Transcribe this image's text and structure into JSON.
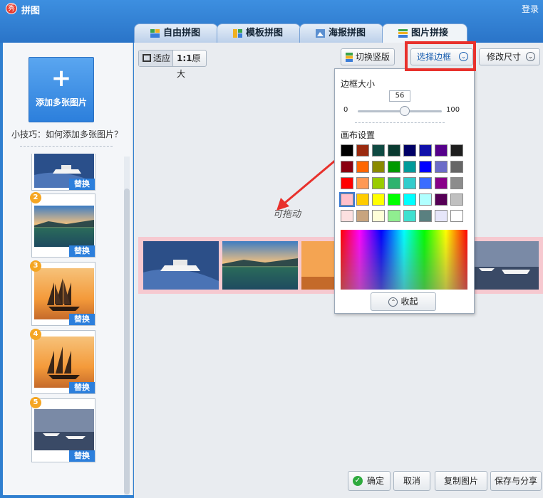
{
  "window": {
    "title": "拼图",
    "login_label": "登录"
  },
  "tabs": [
    {
      "label": "自由拼图",
      "active": false
    },
    {
      "label": "模板拼图",
      "active": false
    },
    {
      "label": "海报拼图",
      "active": false
    },
    {
      "label": "图片拼接",
      "active": true
    }
  ],
  "sidebar": {
    "add_label": "添加多张图片",
    "tip": "小技巧：如何添加多张图片？",
    "replace_label": "替换",
    "items": [
      {
        "number": "",
        "scene": "boat"
      },
      {
        "number": "2",
        "scene": "lake-sunset"
      },
      {
        "number": "3",
        "scene": "sailship"
      },
      {
        "number": "4",
        "scene": "sailship"
      },
      {
        "number": "5",
        "scene": "boats-shore"
      }
    ]
  },
  "toolbar": {
    "fit_label": "适应",
    "original_prefix": "1:1",
    "original_label": "原大",
    "vertical_label": "切换竖版",
    "border_label": "选择边框",
    "resize_label": "修改尺寸"
  },
  "canvas": {
    "hint": "可拖动",
    "strip_color": "#f6c9d0"
  },
  "popup": {
    "border_size_label": "边框大小",
    "slider_value": "56",
    "slider_min": "0",
    "slider_max": "100",
    "canvas_settings_label": "画布设置",
    "collapse_label": "收起",
    "palette": [
      [
        "#000000",
        "#9a2a0f",
        "#0f4a42",
        "#0a3a30",
        "#000066",
        "#1010aa",
        "#55008a",
        "#1e1e1e"
      ],
      [
        "#8a0010",
        "#ff6600",
        "#8a8a00",
        "#009a00",
        "#009a9a",
        "#0000ff",
        "#6c6cc8",
        "#666666"
      ],
      [
        "#ff0000",
        "#ff9955",
        "#99cc00",
        "#2eb36e",
        "#33cccc",
        "#3a6cff",
        "#880088",
        "#8c8c8c"
      ],
      [
        "#ffc0cb",
        "#ffcc00",
        "#ffff00",
        "#00ff00",
        "#00ffff",
        "#b0ffff",
        "#550055",
        "#c0c0c0"
      ],
      [
        "#fce0e0",
        "#c8a47e",
        "#ffffd8",
        "#90ee90",
        "#40e0d0",
        "#5a8080",
        "#e6e6fa",
        "#ffffff"
      ]
    ],
    "selected_swatch": "#ffc0cb"
  },
  "bottom": {
    "ok_label": "确定",
    "cancel_label": "取消",
    "copy_label": "复制图片",
    "save_label": "保存与分享"
  }
}
